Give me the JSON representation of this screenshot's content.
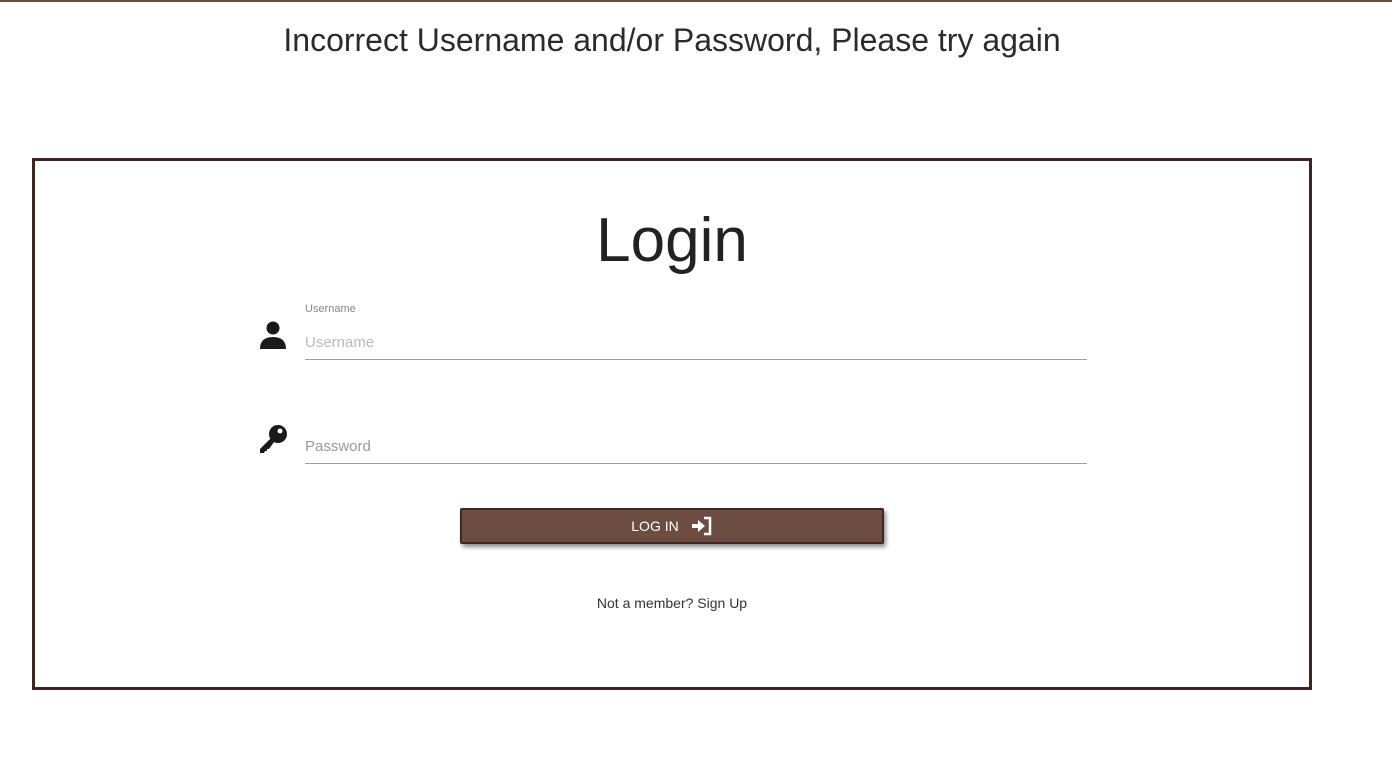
{
  "error_message": "Incorrect Username and/or Password, Please try again",
  "login": {
    "title": "Login",
    "username": {
      "label": "Username",
      "placeholder": "Username",
      "value": "",
      "icon": "user-icon"
    },
    "password": {
      "placeholder": "Password",
      "value": "",
      "icon": "key-icon"
    },
    "button_label": "LOG IN",
    "button_icon": "sign-in-icon",
    "signup_link": "Not a member? Sign Up"
  },
  "colors": {
    "accent": "#6d4c41",
    "border": "#3e2723"
  }
}
